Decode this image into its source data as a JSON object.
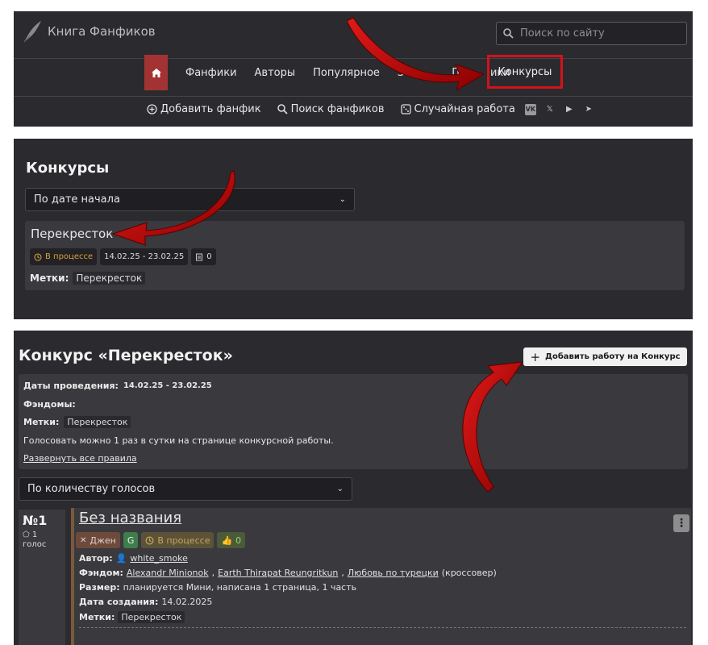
{
  "header": {
    "logo_text": "Книга Фанфиков",
    "search_placeholder": "Поиск по сайту",
    "nav": [
      "Фанфики",
      "Авторы",
      "Популярное",
      "За",
      "По",
      "ики"
    ],
    "nav_contests": "Конкурсы",
    "subnav": {
      "add": "Добавить фанфик",
      "search": "Поиск фанфиков",
      "random": "Случайная работа"
    },
    "social_icons": [
      "vk-icon",
      "x-icon",
      "youtube-icon",
      "telegram-icon"
    ],
    "accent": "#a33332",
    "highlight": "#d4121a"
  },
  "contests_list": {
    "title": "Конкурсы",
    "sort": "По дате начала",
    "card": {
      "title": "Перекресток",
      "status": "В процессе",
      "dates": "14.02.25 - 23.02.25",
      "works_count": "0",
      "tags_label": "Метки:",
      "tag": "Перекресток"
    }
  },
  "contest": {
    "title": "Конкурс «Перекресток»",
    "add_button": "Добавить работу на Конкурс",
    "dates_label": "Даты проведения:",
    "dates": "14.02.25 - 23.02.25",
    "fandoms_label": "Фэндомы:",
    "tags_label": "Метки:",
    "tag": "Перекресток",
    "vote_note": "Голосовать можно 1 раз в сутки на странице конкурсной работы.",
    "rules_link": "Развернуть все правила",
    "sort": "По количеству голосов"
  },
  "entry": {
    "number": "№1",
    "votes_line1": "1",
    "votes_line2": "голос",
    "title": "Без названия",
    "direction": "Джен",
    "rating": "G",
    "status": "В процессе",
    "likes": "0",
    "author_label": "Автор:",
    "author": "white_smoke",
    "fandom_label": "Фэндом:",
    "fandom_1": "Alexandr Minionok",
    "fandom_2": "Earth Thirapat Reungritkun",
    "fandom_3": "Любовь по турецки",
    "fandom_suffix": "(кроссовер)",
    "size_label": "Размер:",
    "size": "планируется Мини, написана 1 страница, 1 часть",
    "created_label": "Дата создания:",
    "created": "14.02.2025",
    "tags_label": "Метки:",
    "tag": "Перекресток"
  }
}
